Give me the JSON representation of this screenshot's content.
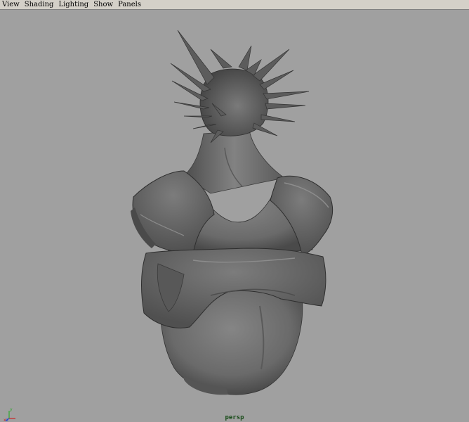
{
  "menubar": {
    "items": [
      {
        "label": "View"
      },
      {
        "label": "Shading"
      },
      {
        "label": "Lighting"
      },
      {
        "label": "Show"
      },
      {
        "label": "Panels"
      }
    ]
  },
  "viewport": {
    "camera_label": "persp",
    "axis": {
      "x_label": "x",
      "y_label": "y",
      "z_label": "z"
    },
    "colors": {
      "background": "#a0a0a0",
      "model_base": "#6e6e6e",
      "model_dark": "#3c3c3c",
      "model_light": "#8a8a8a"
    }
  }
}
